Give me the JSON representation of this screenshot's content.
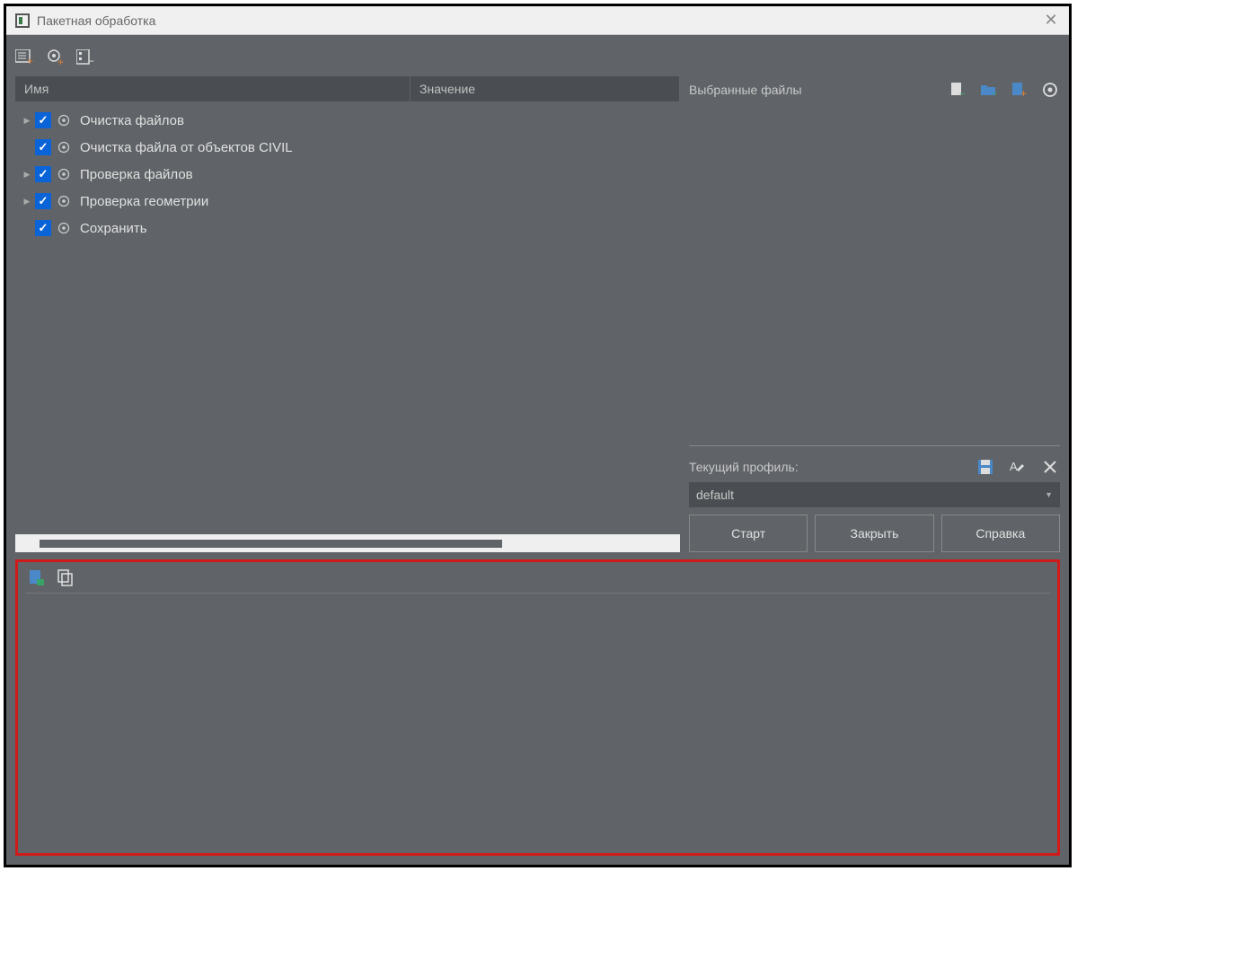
{
  "window": {
    "title": "Пакетная обработка"
  },
  "columns": {
    "name": "Имя",
    "value": "Значение"
  },
  "tree": {
    "items": [
      {
        "expandable": true,
        "checked": true,
        "label": "Очистка файлов"
      },
      {
        "expandable": false,
        "checked": true,
        "label": "Очистка файла от объектов CIVIL"
      },
      {
        "expandable": true,
        "checked": true,
        "label": "Проверка файлов"
      },
      {
        "expandable": true,
        "checked": true,
        "label": "Проверка геометрии"
      },
      {
        "expandable": false,
        "checked": true,
        "label": "Сохранить"
      }
    ]
  },
  "right": {
    "selected_files_label": "Выбранные файлы",
    "current_profile_label": "Текущий профиль:",
    "profile_value": "default"
  },
  "buttons": {
    "start": "Старт",
    "close": "Закрыть",
    "help": "Справка"
  }
}
